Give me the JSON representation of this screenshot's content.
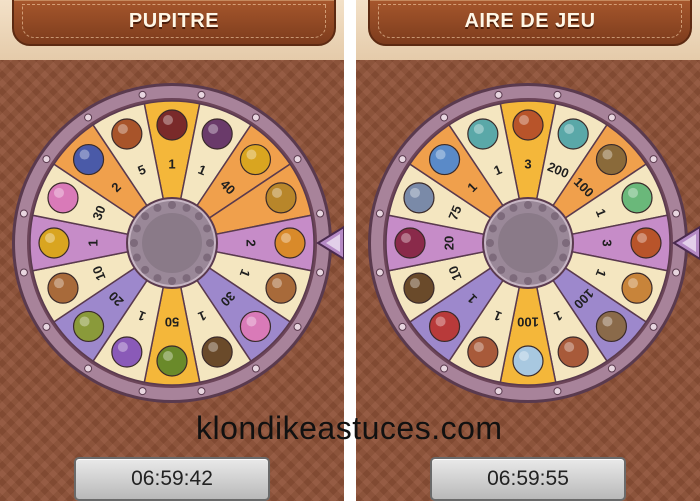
{
  "panels": [
    {
      "title": "PUPITRE",
      "timer": "06:59:42",
      "segments": [
        {
          "label": "1",
          "icon": "cherry-tart-icon",
          "color": "#f4b73a"
        },
        {
          "label": "1",
          "icon": "berry-cake-icon",
          "color": "#f4e6c0"
        },
        {
          "label": "40",
          "icon": "gold-coin-icon",
          "color": "#f0a04c"
        },
        {
          "label": "",
          "icon": "pickaxe-icon",
          "color": "#f0a04c"
        },
        {
          "label": "2",
          "icon": "waffle-icon",
          "color": "#c68cc8"
        },
        {
          "label": "1",
          "icon": "cookie-icon",
          "color": "#f4e6c0"
        },
        {
          "label": "30",
          "icon": "worm-icon",
          "color": "#9d88cc"
        },
        {
          "label": "1",
          "icon": "bucket-icon",
          "color": "#f4e6c0"
        },
        {
          "label": "50",
          "icon": "herb-bundle-icon",
          "color": "#f4b73a"
        },
        {
          "label": "1",
          "icon": "yarn-icon",
          "color": "#f4e6c0"
        },
        {
          "label": "20",
          "icon": "seeds-bowl-icon",
          "color": "#9d88cc"
        },
        {
          "label": "10",
          "icon": "cookie-icon",
          "color": "#f4e6c0"
        },
        {
          "label": "1",
          "icon": "gold-coin-icon",
          "color": "#c68cc8"
        },
        {
          "label": "30",
          "icon": "worm-icon",
          "color": "#f4e6c0"
        },
        {
          "label": "2",
          "icon": "rope-coil-icon",
          "color": "#f0a04c"
        },
        {
          "label": "5",
          "icon": "pretzel-icon",
          "color": "#f4e6c0"
        }
      ]
    },
    {
      "title": "AIRE DE JEU",
      "timer": "06:59:55",
      "segments": [
        {
          "label": "3",
          "icon": "pie-icon",
          "color": "#f4b73a"
        },
        {
          "label": "200",
          "icon": "cup-icon",
          "color": "#f4e6c0"
        },
        {
          "label": "100",
          "icon": "basket-icon",
          "color": "#f0a04c"
        },
        {
          "label": "1",
          "icon": "teapot-icon",
          "color": "#f4e6c0"
        },
        {
          "label": "3",
          "icon": "pie-icon",
          "color": "#c68cc8"
        },
        {
          "label": "1",
          "icon": "croissant-icon",
          "color": "#f4e6c0"
        },
        {
          "label": "100",
          "icon": "sack-icon",
          "color": "#9d88cc"
        },
        {
          "label": "1",
          "icon": "bread-bowl-icon",
          "color": "#f4e6c0"
        },
        {
          "label": "100",
          "icon": "crystal-rock-icon",
          "color": "#f4b73a"
        },
        {
          "label": "1",
          "icon": "bread-bowl-icon",
          "color": "#f4e6c0"
        },
        {
          "label": "1",
          "icon": "necklace-icon",
          "color": "#9d88cc"
        },
        {
          "label": "10",
          "icon": "bucket-icon",
          "color": "#f4e6c0"
        },
        {
          "label": "20",
          "icon": "berry-tart-icon",
          "color": "#c68cc8"
        },
        {
          "label": "75",
          "icon": "jar-icon",
          "color": "#f4e6c0"
        },
        {
          "label": "1",
          "icon": "crystal-ball-icon",
          "color": "#f0a04c"
        },
        {
          "label": "1",
          "icon": "cup-icon",
          "color": "#f4e6c0"
        }
      ]
    }
  ],
  "watermark": "klondikeastuces.com",
  "colors": {
    "rim": "#a8839a",
    "rim_dark": "#5a3a4e",
    "hub": "#9a8898",
    "pointer": "#b58ac5"
  }
}
